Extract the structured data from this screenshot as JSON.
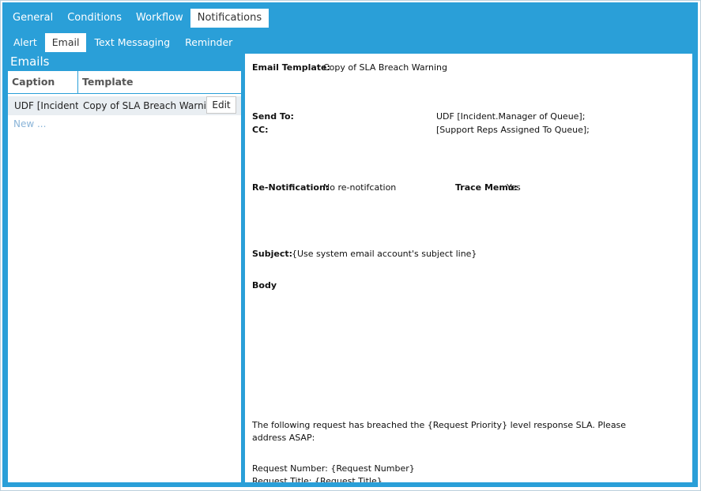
{
  "tabs_main": [
    "General",
    "Conditions",
    "Workflow",
    "Notifications"
  ],
  "tabs_main_active": "Notifications",
  "tabs_sub": [
    "Alert",
    "Email",
    "Text Messaging",
    "Reminder"
  ],
  "tabs_sub_active": "Email",
  "emails_panel": {
    "title": "Emails",
    "columns": {
      "caption": "Caption",
      "template": "Template"
    },
    "rows": [
      {
        "caption": "UDF [Incident.Manager of Queue]",
        "template": "Copy of SLA Breach Warning",
        "edit_label": "Edit"
      }
    ],
    "new_link": "New ..."
  },
  "detail": {
    "email_template_label": "Email Template:",
    "email_template_value": "Copy of SLA Breach Warning",
    "send_to_label": "Send To:",
    "send_to_value": "UDF [Incident.Manager of Queue];",
    "cc_label": "CC:",
    "cc_value": "[Support Reps Assigned To Queue];",
    "renotification_label": "Re-Notification:",
    "renotification_value": "No re-notifcation",
    "trace_memo_label": "Trace Memo:",
    "trace_memo_value": "Yes",
    "subject_label": "Subject:",
    "subject_value": "{Use system email account's subject line}",
    "body_label": "Body",
    "body_paragraph": "The following request has breached the {Request Priority} level response SLA. Please address ASAP:",
    "request_number": "Request Number: {Request Number}",
    "request_title": "Request Title: {Request Title}"
  },
  "colors": {
    "accent": "#2a9fd8",
    "row_selected": "#e9eef2",
    "link": "#8ab4d8"
  }
}
